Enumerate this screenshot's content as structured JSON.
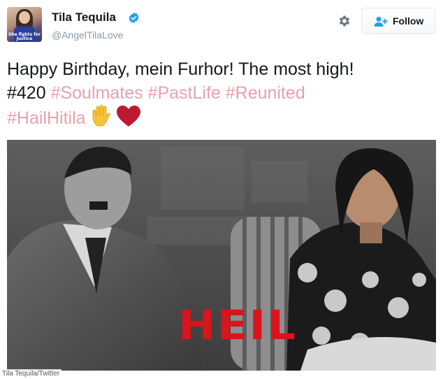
{
  "user": {
    "display_name": "Tila Tequila",
    "handle": "@AngelTilaLove",
    "avatar_caption": "She fights for Justice"
  },
  "actions": {
    "follow_label": "Follow"
  },
  "tweet": {
    "text_plain": "Happy Birthday, mein Furhor! The most high!",
    "hashtag_420": "#420",
    "hashtag_soulmates": "#Soulmates",
    "hashtag_pastlife": "#PastLife",
    "hashtag_reunited": "#Reunited",
    "hashtag_hailhitila": "#HailHitila",
    "emoji_hand": "✋",
    "emoji_heart": "❤"
  },
  "media": {
    "overlay_text": "HEIL",
    "credit": "Tila Tequila/Twitter"
  },
  "colors": {
    "hashtag": "#e8a1ad",
    "verified": "#1da1f2",
    "follow_icon": "#1da1f2",
    "overlay": "#d8141c"
  },
  "icons": [
    "verified-badge-icon",
    "gear-icon",
    "follow-user-icon",
    "raised-hand-emoji",
    "heart-emoji"
  ]
}
